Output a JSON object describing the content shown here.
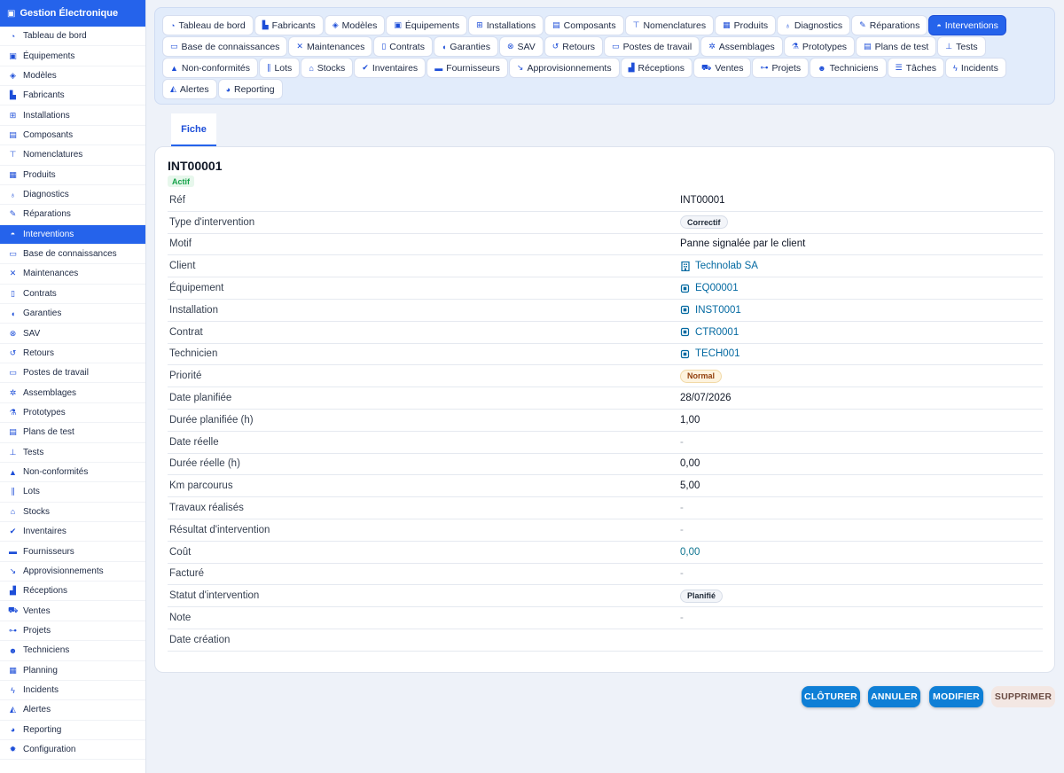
{
  "app": {
    "title": "Gestion Électronique",
    "icon": "chip-icon"
  },
  "sidebar": {
    "items": [
      {
        "label": "Tableau de bord",
        "icon": "gauge-icon",
        "glyph": "◔"
      },
      {
        "label": "Équipements",
        "icon": "chip-icon",
        "glyph": "▣"
      },
      {
        "label": "Modèles",
        "icon": "cube-icon",
        "glyph": "◈"
      },
      {
        "label": "Fabricants",
        "icon": "factory-icon",
        "glyph": "▙"
      },
      {
        "label": "Installations",
        "icon": "sitemap-icon",
        "glyph": "⊞"
      },
      {
        "label": "Composants",
        "icon": "memory-icon",
        "glyph": "▤"
      },
      {
        "label": "Nomenclatures",
        "icon": "hierarchy-icon",
        "glyph": "⊤"
      },
      {
        "label": "Produits",
        "icon": "box-icon",
        "glyph": "▦"
      },
      {
        "label": "Diagnostics",
        "icon": "stethoscope-icon",
        "glyph": "♁"
      },
      {
        "label": "Réparations",
        "icon": "wrench-icon",
        "glyph": "✎"
      },
      {
        "label": "Interventions",
        "icon": "helmet-icon",
        "glyph": "◓",
        "active": true
      },
      {
        "label": "Base de connaissances",
        "icon": "book-icon",
        "glyph": "▭"
      },
      {
        "label": "Maintenances",
        "icon": "tools-icon",
        "glyph": "✕"
      },
      {
        "label": "Contrats",
        "icon": "file-icon",
        "glyph": "▯"
      },
      {
        "label": "Garanties",
        "icon": "shield-icon",
        "glyph": "◖"
      },
      {
        "label": "SAV",
        "icon": "lifebuoy-icon",
        "glyph": "⊗"
      },
      {
        "label": "Retours",
        "icon": "undo-icon",
        "glyph": "↺"
      },
      {
        "label": "Postes de travail",
        "icon": "monitor-icon",
        "glyph": "▭"
      },
      {
        "label": "Assemblages",
        "icon": "gears-icon",
        "glyph": "✲"
      },
      {
        "label": "Prototypes",
        "icon": "flask-icon",
        "glyph": "⚗"
      },
      {
        "label": "Plans de test",
        "icon": "clipboard-icon",
        "glyph": "▤"
      },
      {
        "label": "Tests",
        "icon": "vial-icon",
        "glyph": "⊥"
      },
      {
        "label": "Non-conformités",
        "icon": "warning-icon",
        "glyph": "▲"
      },
      {
        "label": "Lots",
        "icon": "barcode-icon",
        "glyph": "∥"
      },
      {
        "label": "Stocks",
        "icon": "warehouse-icon",
        "glyph": "⌂"
      },
      {
        "label": "Inventaires",
        "icon": "clipboard-check-icon",
        "glyph": "✔"
      },
      {
        "label": "Fournisseurs",
        "icon": "truck-icon",
        "glyph": "▬"
      },
      {
        "label": "Approvisionnements",
        "icon": "dolly-icon",
        "glyph": "↘"
      },
      {
        "label": "Réceptions",
        "icon": "truck-loading-icon",
        "glyph": "▟"
      },
      {
        "label": "Ventes",
        "icon": "cart-icon",
        "glyph": "⛟"
      },
      {
        "label": "Projets",
        "icon": "diagram-icon",
        "glyph": "⊶"
      },
      {
        "label": "Techniciens",
        "icon": "users-gear-icon",
        "glyph": "☻"
      },
      {
        "label": "Planning",
        "icon": "calendar-icon",
        "glyph": "▦"
      },
      {
        "label": "Incidents",
        "icon": "bolt-icon",
        "glyph": "ϟ"
      },
      {
        "label": "Alertes",
        "icon": "bell-icon",
        "glyph": "◭"
      },
      {
        "label": "Reporting",
        "icon": "pie-chart-icon",
        "glyph": "◕"
      },
      {
        "label": "Configuration",
        "icon": "gear-icon",
        "glyph": "✹"
      }
    ]
  },
  "tabs": [
    {
      "label": "Tableau de bord",
      "icon": "gauge-icon",
      "glyph": "◔"
    },
    {
      "label": "Fabricants",
      "icon": "factory-icon",
      "glyph": "▙"
    },
    {
      "label": "Modèles",
      "icon": "cube-icon",
      "glyph": "◈"
    },
    {
      "label": "Équipements",
      "icon": "chip-icon",
      "glyph": "▣"
    },
    {
      "label": "Installations",
      "icon": "sitemap-icon",
      "glyph": "⊞"
    },
    {
      "label": "Composants",
      "icon": "memory-icon",
      "glyph": "▤"
    },
    {
      "label": "Nomenclatures",
      "icon": "hierarchy-icon",
      "glyph": "⊤"
    },
    {
      "label": "Produits",
      "icon": "box-icon",
      "glyph": "▦"
    },
    {
      "label": "Diagnostics",
      "icon": "stethoscope-icon",
      "glyph": "♁"
    },
    {
      "label": "Réparations",
      "icon": "wrench-icon",
      "glyph": "✎"
    },
    {
      "label": "Interventions",
      "icon": "helmet-icon",
      "glyph": "◓",
      "active": true
    },
    {
      "label": "Base de connaissances",
      "icon": "book-icon",
      "glyph": "▭"
    },
    {
      "label": "Maintenances",
      "icon": "tools-icon",
      "glyph": "✕"
    },
    {
      "label": "Contrats",
      "icon": "file-icon",
      "glyph": "▯"
    },
    {
      "label": "Garanties",
      "icon": "shield-icon",
      "glyph": "◖"
    },
    {
      "label": "SAV",
      "icon": "lifebuoy-icon",
      "glyph": "⊗"
    },
    {
      "label": "Retours",
      "icon": "undo-icon",
      "glyph": "↺"
    },
    {
      "label": "Postes de travail",
      "icon": "monitor-icon",
      "glyph": "▭"
    },
    {
      "label": "Assemblages",
      "icon": "gears-icon",
      "glyph": "✲"
    },
    {
      "label": "Prototypes",
      "icon": "flask-icon",
      "glyph": "⚗"
    },
    {
      "label": "Plans de test",
      "icon": "clipboard-icon",
      "glyph": "▤"
    },
    {
      "label": "Tests",
      "icon": "vial-icon",
      "glyph": "⊥"
    },
    {
      "label": "Non-conformités",
      "icon": "warning-icon",
      "glyph": "▲"
    },
    {
      "label": "Lots",
      "icon": "barcode-icon",
      "glyph": "∥"
    },
    {
      "label": "Stocks",
      "icon": "warehouse-icon",
      "glyph": "⌂"
    },
    {
      "label": "Inventaires",
      "icon": "clipboard-check-icon",
      "glyph": "✔"
    },
    {
      "label": "Fournisseurs",
      "icon": "truck-icon",
      "glyph": "▬"
    },
    {
      "label": "Approvisionnements",
      "icon": "dolly-icon",
      "glyph": "↘"
    },
    {
      "label": "Réceptions",
      "icon": "truck-loading-icon",
      "glyph": "▟"
    },
    {
      "label": "Ventes",
      "icon": "cart-icon",
      "glyph": "⛟"
    },
    {
      "label": "Projets",
      "icon": "diagram-icon",
      "glyph": "⊶"
    },
    {
      "label": "Techniciens",
      "icon": "users-gear-icon",
      "glyph": "☻"
    },
    {
      "label": "Tâches",
      "icon": "list-icon",
      "glyph": "☰"
    },
    {
      "label": "Incidents",
      "icon": "bolt-icon",
      "glyph": "ϟ"
    },
    {
      "label": "Alertes",
      "icon": "bell-icon",
      "glyph": "◭"
    },
    {
      "label": "Reporting",
      "icon": "pie-chart-icon",
      "glyph": "◕"
    }
  ],
  "subtab": {
    "label": "Fiche"
  },
  "record": {
    "id": "INT00001",
    "status_badge": "Actif",
    "fields": [
      {
        "label": "Réf",
        "value": "INT00001",
        "kind": "text"
      },
      {
        "label": "Type d'intervention",
        "value": "Correctif",
        "kind": "chip"
      },
      {
        "label": "Motif",
        "value": "Panne signalée par le client",
        "kind": "text"
      },
      {
        "label": "Client",
        "value": "Technolab SA",
        "kind": "link",
        "icon": "building-icon"
      },
      {
        "label": "Équipement",
        "value": "EQ00001",
        "kind": "link",
        "icon": "chip-icon"
      },
      {
        "label": "Installation",
        "value": "INST0001",
        "kind": "link",
        "icon": "chip-icon"
      },
      {
        "label": "Contrat",
        "value": "CTR0001",
        "kind": "link",
        "icon": "chip-icon"
      },
      {
        "label": "Technicien",
        "value": "TECH001",
        "kind": "link",
        "icon": "chip-icon"
      },
      {
        "label": "Priorité",
        "value": "Normal",
        "kind": "chip-warn"
      },
      {
        "label": "Date planifiée",
        "value": "28/07/2026",
        "kind": "text"
      },
      {
        "label": "Durée planifiée (h)",
        "value": "1,00",
        "kind": "text"
      },
      {
        "label": "Date réelle",
        "value": "-",
        "kind": "dash"
      },
      {
        "label": "Durée réelle (h)",
        "value": "0,00",
        "kind": "text"
      },
      {
        "label": "Km parcourus",
        "value": "5,00",
        "kind": "text"
      },
      {
        "label": "Travaux réalisés",
        "value": "-",
        "kind": "dash"
      },
      {
        "label": "Résultat d'intervention",
        "value": "-",
        "kind": "dash"
      },
      {
        "label": "Coût",
        "value": "0,00",
        "kind": "teal"
      },
      {
        "label": "Facturé",
        "value": "-",
        "kind": "dash"
      },
      {
        "label": "Statut d'intervention",
        "value": "Planifié",
        "kind": "chip"
      },
      {
        "label": "Note",
        "value": "-",
        "kind": "dash"
      },
      {
        "label": "Date création",
        "value": "",
        "kind": "text"
      }
    ]
  },
  "actions": {
    "close_label": "CLÔTURER",
    "cancel_label": "ANNULER",
    "edit_label": "MODIFIER",
    "delete_label": "SUPPRIMER"
  },
  "colors": {
    "accent": "#2563eb",
    "action": "#0e7fd6",
    "link": "#0369a1",
    "active_badge": "#16a34a"
  }
}
